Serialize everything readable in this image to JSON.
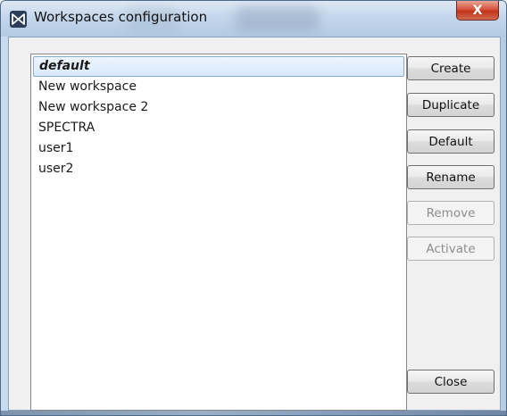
{
  "window": {
    "title": "Workspaces configuration",
    "close_symbol": "X",
    "icon": "bowtie-app-icon"
  },
  "workspaces": {
    "items": [
      {
        "label": "default",
        "selected": true
      },
      {
        "label": "New workspace",
        "selected": false
      },
      {
        "label": "New workspace 2",
        "selected": false
      },
      {
        "label": "SPECTRA",
        "selected": false
      },
      {
        "label": "user1",
        "selected": false
      },
      {
        "label": "user2",
        "selected": false
      }
    ]
  },
  "buttons": {
    "create": {
      "label": "Create",
      "enabled": true
    },
    "duplicate": {
      "label": "Duplicate",
      "enabled": true
    },
    "default": {
      "label": "Default",
      "enabled": true
    },
    "rename": {
      "label": "Rename",
      "enabled": true
    },
    "remove": {
      "label": "Remove",
      "enabled": false
    },
    "activate": {
      "label": "Activate",
      "enabled": false
    },
    "close": {
      "label": "Close",
      "enabled": true
    }
  },
  "colors": {
    "selection_border": "#84acdd",
    "close_button": "#c1331b",
    "disabled_text": "#8d8d8d"
  }
}
